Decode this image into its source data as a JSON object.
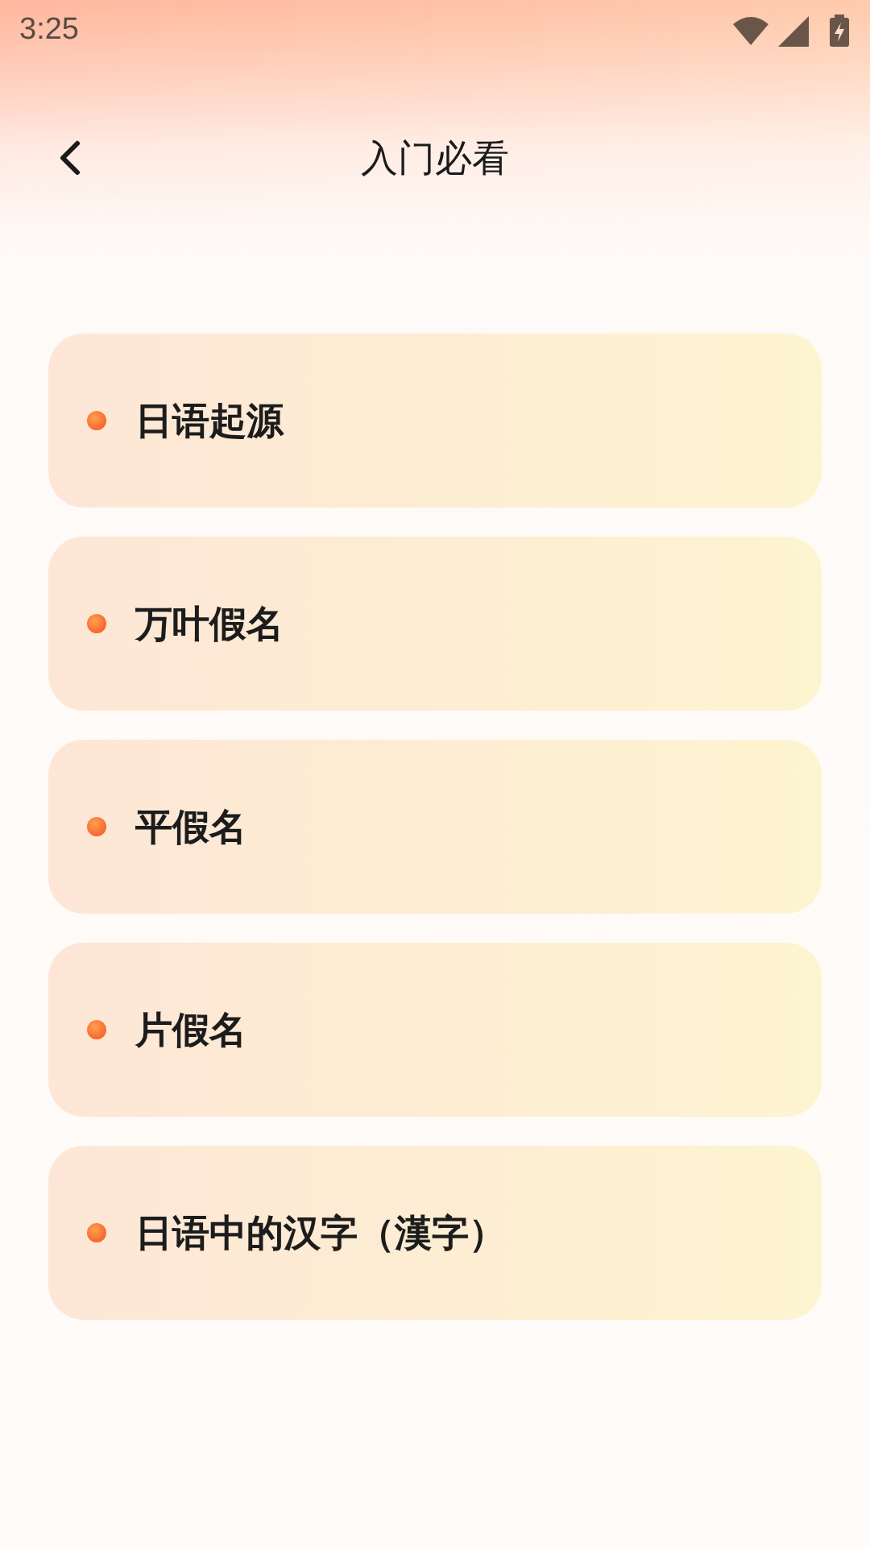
{
  "status_bar": {
    "time": "3:25"
  },
  "header": {
    "title": "入门必看"
  },
  "items": [
    {
      "label": "日语起源"
    },
    {
      "label": "万叶假名"
    },
    {
      "label": "平假名"
    },
    {
      "label": "片假名"
    },
    {
      "label": "日语中的汉字（漢字）"
    }
  ]
}
